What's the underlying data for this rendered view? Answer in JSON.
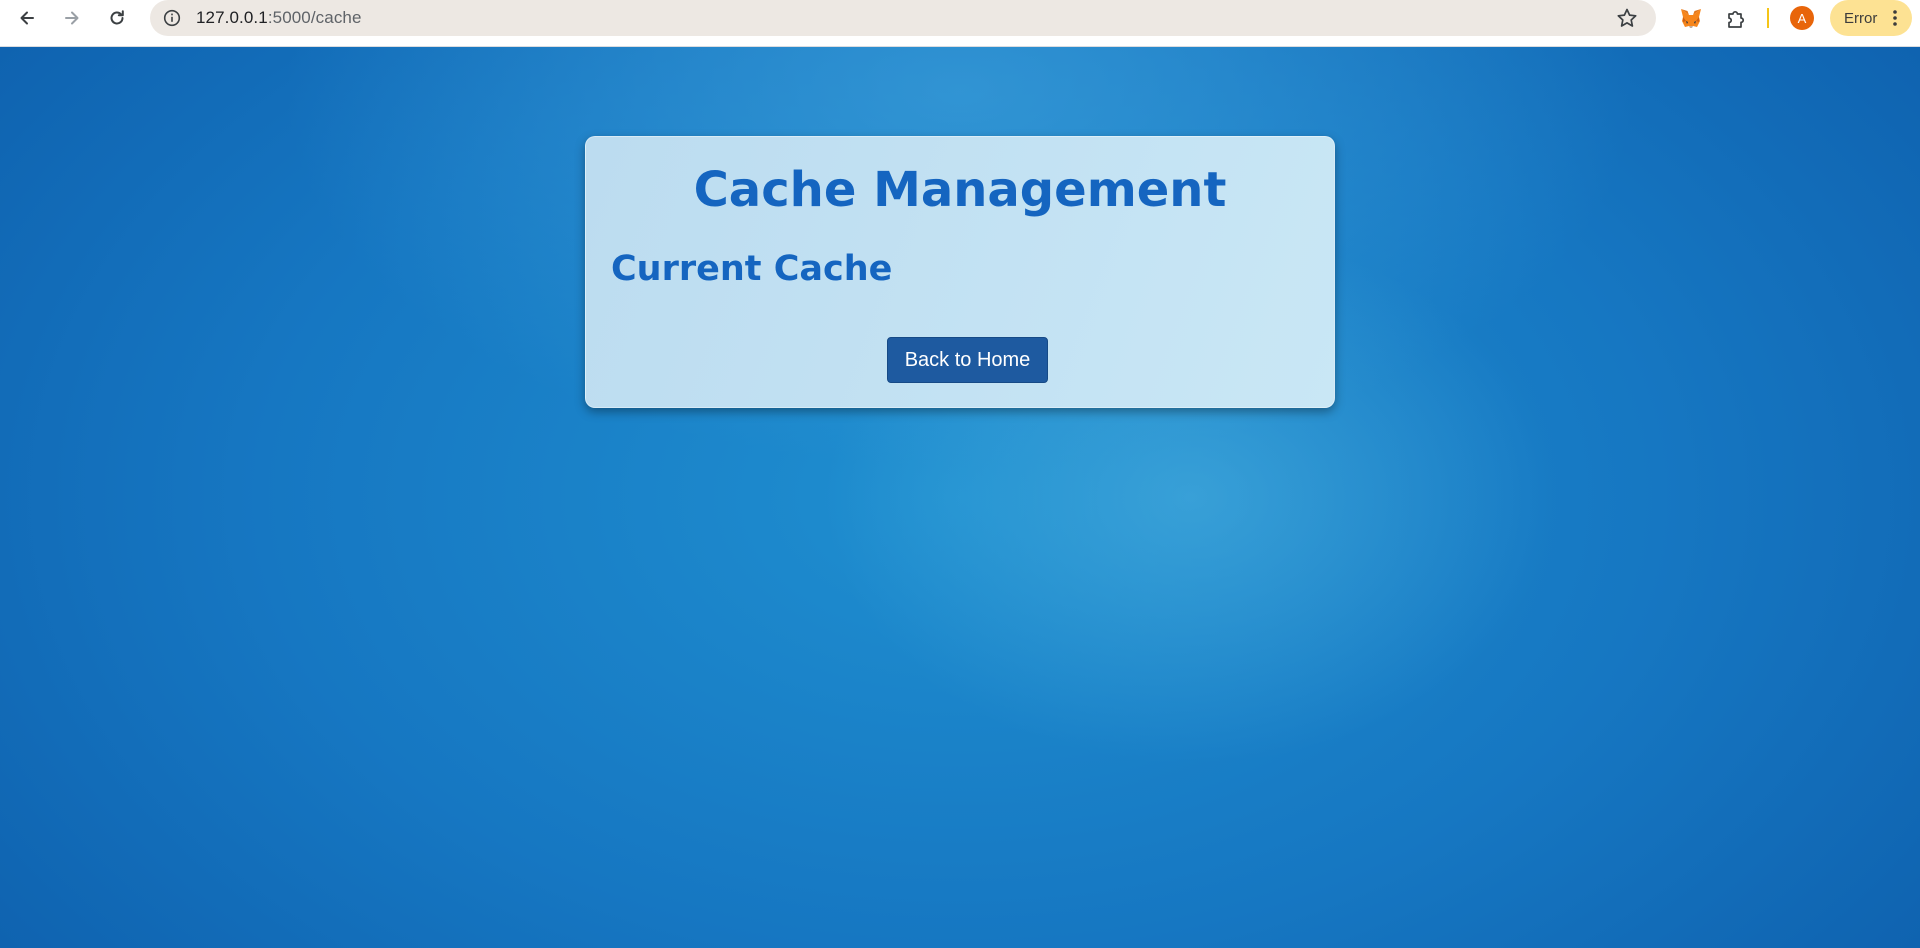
{
  "browser": {
    "url_host": "127.0.0.1",
    "url_path": ":5000/cache",
    "profile_initial": "A",
    "error_label": "Error",
    "icons": {
      "back": "arrow-left-icon",
      "forward": "arrow-right-icon",
      "reload": "reload-icon",
      "site_info": "info-icon",
      "bookmark": "star-icon",
      "extension_metamask": "fox-icon",
      "extensions": "puzzle-icon",
      "menu": "kebab-icon"
    },
    "colors": {
      "omnibox_bg": "#ede8e3",
      "avatar_bg": "#e8650a",
      "error_chip_bg": "#fde293"
    }
  },
  "page": {
    "title": "Cache Management",
    "subtitle": "Current Cache",
    "home_button_label": "Back to Home",
    "colors": {
      "heading": "#1565c0",
      "button_bg": "#1e5aa0",
      "card_bg": "#c3e2f3",
      "background": "#1677c2"
    }
  }
}
